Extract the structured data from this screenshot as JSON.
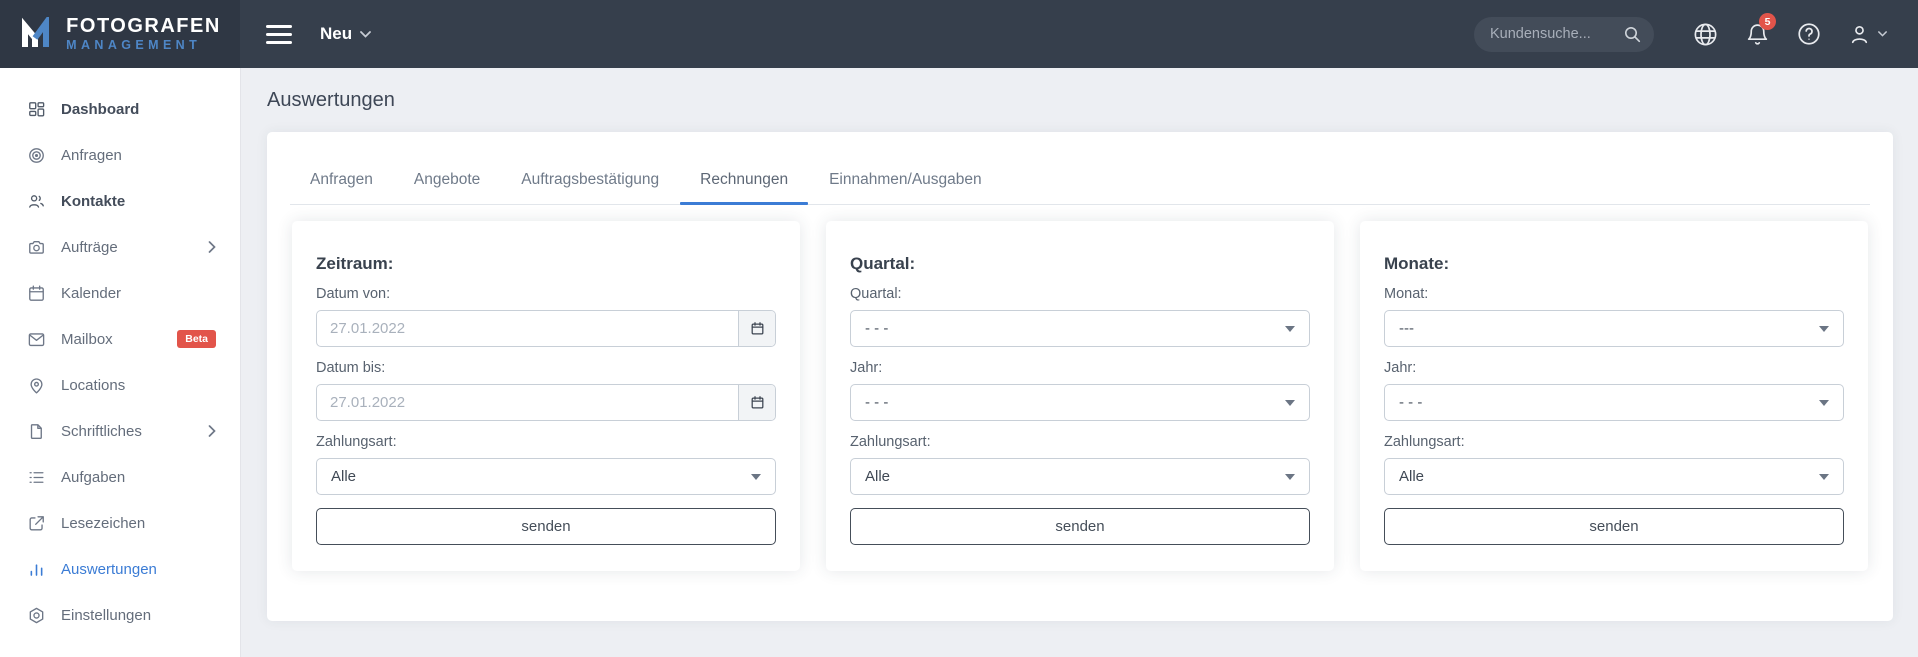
{
  "navbar": {
    "logo_line1": "FOTOGRAFEN",
    "logo_line2": "MANAGEMENT",
    "menu_label": "Neu",
    "search_placeholder": "Kundensuche...",
    "notification_count": "5"
  },
  "sidebar": {
    "beta_badge": "Beta",
    "items": [
      {
        "label": "Dashboard",
        "icon": "dashboard-grid-icon"
      },
      {
        "label": "Anfragen",
        "icon": "target-icon"
      },
      {
        "label": "Kontakte",
        "icon": "users-icon"
      },
      {
        "label": "Aufträge",
        "icon": "camera-icon"
      },
      {
        "label": "Kalender",
        "icon": "calendar-icon"
      },
      {
        "label": "Mailbox",
        "icon": "envelope-icon"
      },
      {
        "label": "Locations",
        "icon": "map-pin-icon"
      },
      {
        "label": "Schriftliches",
        "icon": "document-icon"
      },
      {
        "label": "Aufgaben",
        "icon": "list-icon"
      },
      {
        "label": "Lesezeichen",
        "icon": "external-link-icon"
      },
      {
        "label": "Auswertungen",
        "icon": "bar-chart-icon"
      },
      {
        "label": "Einstellungen",
        "icon": "gear-icon"
      }
    ]
  },
  "page": {
    "title": "Auswertungen"
  },
  "tabs": [
    {
      "label": "Anfragen",
      "active": false
    },
    {
      "label": "Angebote",
      "active": false
    },
    {
      "label": "Auftragsbestätigung",
      "active": false
    },
    {
      "label": "Rechnungen",
      "active": true
    },
    {
      "label": "Einnahmen/Ausgaben",
      "active": false
    }
  ],
  "panels": {
    "zeitraum": {
      "title": "Zeitraum:",
      "date_from_label": "Datum von:",
      "date_from_value": "27.01.2022",
      "date_to_label": "Datum bis:",
      "date_to_value": "27.01.2022",
      "payment_label": "Zahlungsart:",
      "payment_value": "Alle",
      "submit_label": "senden"
    },
    "quartal": {
      "title": "Quartal:",
      "quarter_label": "Quartal:",
      "quarter_value": "- - -",
      "year_label": "Jahr:",
      "year_value": "- - -",
      "payment_label": "Zahlungsart:",
      "payment_value": "Alle",
      "submit_label": "senden"
    },
    "monate": {
      "title": "Monate:",
      "month_label": "Monat:",
      "month_value": "---",
      "year_label": "Jahr:",
      "year_value": "- - -",
      "payment_label": "Zahlungsart:",
      "payment_value": "Alle",
      "submit_label": "senden"
    }
  },
  "colors": {
    "navbar_bg": "#363f4c",
    "logo_area_bg": "#2f3744",
    "accent_blue": "#3b7cd5",
    "logo_blue": "#4e86c6",
    "badge_red": "#e2544a",
    "content_bg": "#edeff3"
  }
}
